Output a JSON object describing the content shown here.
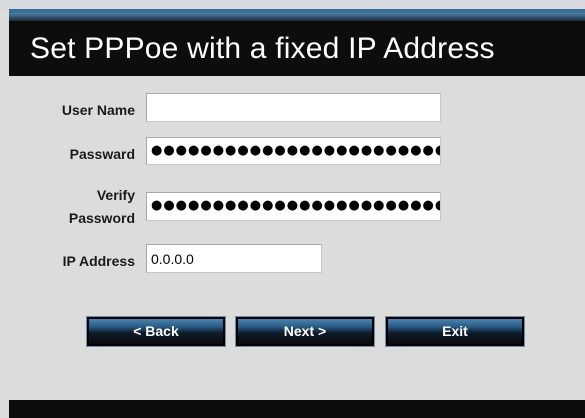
{
  "dialog": {
    "title": "Set PPPoe with a fixed IP Address"
  },
  "form": {
    "user_name": {
      "label": "User Name",
      "value": ""
    },
    "password": {
      "label": "Passward",
      "masked_value": "●●●●●●●●●●●●●●●●●●●●●●●●●"
    },
    "verify_password": {
      "label_line1": "Verify",
      "label_line2": "Password",
      "masked_value": "●●●●●●●●●●●●●●●●●●●●●●●●●"
    },
    "ip_address": {
      "label": "IP Address",
      "value": "0.0.0.0"
    }
  },
  "buttons": {
    "back": "< Back",
    "next": "Next >",
    "exit": "Exit"
  },
  "colors": {
    "title_bar": "#0d0d0d",
    "accent": "#3c6e95",
    "panel": "#dcdcdc"
  }
}
